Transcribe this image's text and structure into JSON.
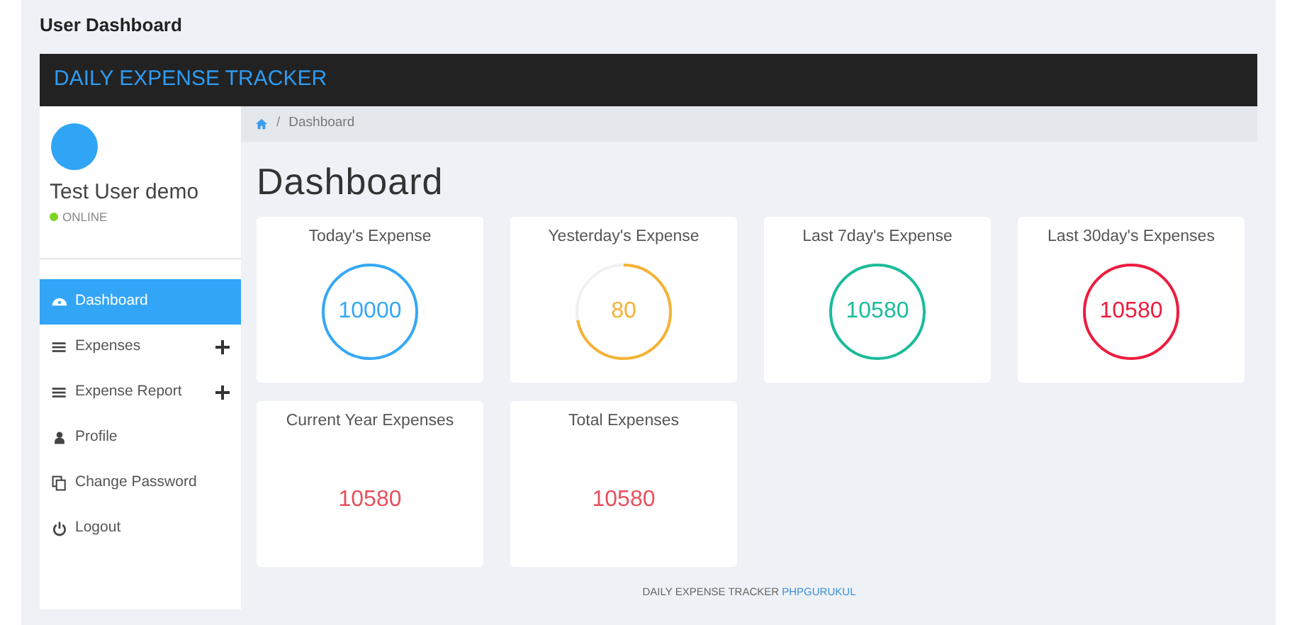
{
  "page_title": "User Dashboard",
  "navbar": {
    "brand": "DAILY EXPENSE TRACKER"
  },
  "sidebar": {
    "user": {
      "name": "Test User demo",
      "status": "ONLINE",
      "online": true
    },
    "items": [
      {
        "label": "Dashboard",
        "selected": true,
        "expandable": false
      },
      {
        "label": "Expenses",
        "selected": false,
        "expandable": true
      },
      {
        "label": "Expense Report",
        "selected": false,
        "expandable": true
      },
      {
        "label": "Profile",
        "selected": false,
        "expandable": false
      },
      {
        "label": "Change Password",
        "selected": false,
        "expandable": false
      },
      {
        "label": "Logout",
        "selected": false,
        "expandable": false
      }
    ]
  },
  "breadcrumb": {
    "separator": "/",
    "items": [
      "Dashboard"
    ]
  },
  "heading": "Dashboard",
  "cards": [
    {
      "kind": "ring",
      "title": "Today's Expense",
      "value": "10000",
      "color": "#35a8f5"
    },
    {
      "kind": "ring",
      "title": "Yesterday's Expense",
      "value": "80",
      "color": "#f6b235"
    },
    {
      "kind": "ring",
      "title": "Last 7day's Expense",
      "value": "10580",
      "color": "#1bbc9b"
    },
    {
      "kind": "ring",
      "title": "Last 30day's Expenses",
      "value": "10580",
      "color": "#ec1c3e"
    },
    {
      "kind": "plain",
      "title": "Current Year Expenses",
      "value": "10580",
      "color": "#e8505b"
    },
    {
      "kind": "plain",
      "title": "Total Expenses",
      "value": "10580",
      "color": "#e8505b"
    }
  ],
  "footer": {
    "text": "DAILY EXPENSE TRACKER",
    "link": "PHPGURUKUL"
  }
}
